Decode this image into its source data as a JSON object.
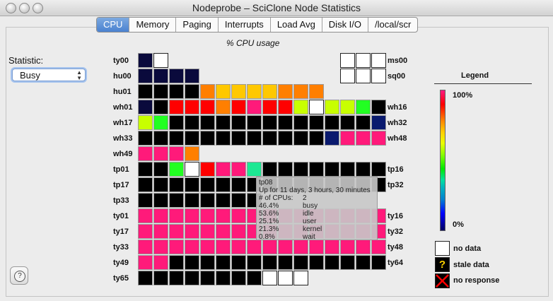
{
  "window": {
    "title": "Nodeprobe – SciClone Node Statistics"
  },
  "tabs": [
    {
      "label": "CPU",
      "selected": true
    },
    {
      "label": "Memory",
      "selected": false
    },
    {
      "label": "Paging",
      "selected": false
    },
    {
      "label": "Interrupts",
      "selected": false
    },
    {
      "label": "Load Avg",
      "selected": false
    },
    {
      "label": "Disk I/O",
      "selected": false
    },
    {
      "label": "/local/scr",
      "selected": false
    }
  ],
  "plot_title": "% CPU usage",
  "statistic": {
    "label": "Statistic:",
    "value": "Busy"
  },
  "help_button": {
    "icon": "question-icon",
    "label": "?"
  },
  "colors": {
    "B": "#000000",
    "N": "#0a0a3c",
    "W": "#ffffff",
    "O": "#ff7f00",
    "Y": "#ffc800",
    "R": "#ff0000",
    "P": "#ff1a7a",
    "L": "#c8ff00",
    "G": "#22ff22",
    "T": "#1de893",
    "U": "#0a1a6e"
  },
  "grid": [
    {
      "left": "ty00",
      "right": "ms00",
      "cells": "NW",
      "right_cells": "WWW"
    },
    {
      "left": "hu00",
      "right": "sq00",
      "cells": "NNNN",
      "right_cells": "WWW"
    },
    {
      "left": "hu01",
      "right": "",
      "cells": "BBBBOYYYYOOO",
      "right_cells": ""
    },
    {
      "left": "wh01",
      "right": "wh16",
      "cells": "NBRRRORPRRLWLLGB",
      "right_cells": ""
    },
    {
      "left": "wh17",
      "right": "wh32",
      "cells": "LGBBBBBBBBBBBBBU",
      "right_cells": ""
    },
    {
      "left": "wh33",
      "right": "wh48",
      "cells": "BBBBBBBBBBBBUPPP",
      "right_cells": ""
    },
    {
      "left": "wh49",
      "right": "",
      "cells": "PPPO",
      "right_cells": ""
    },
    {
      "left": "tp01",
      "right": "tp16",
      "cells": "BBGWRPPTBBBBBBBB",
      "right_cells": ""
    },
    {
      "left": "tp17",
      "right": "tp32",
      "cells": "BBBBBBBBBBBBBBBB",
      "right_cells": ""
    },
    {
      "left": "tp33",
      "right": "",
      "cells": "BBBBBBBB",
      "right_cells": ""
    },
    {
      "left": "ty01",
      "right": "ty16",
      "cells": "PPPPPPPPPPPPPPPP",
      "right_cells": ""
    },
    {
      "left": "ty17",
      "right": "ty32",
      "cells": "PPPPPPPPPPPPPPPP",
      "right_cells": ""
    },
    {
      "left": "ty33",
      "right": "ty48",
      "cells": "PPPPPPPPPPPPPPPP",
      "right_cells": ""
    },
    {
      "left": "ty49",
      "right": "ty64",
      "cells": "PPBBBBBBBBBBBBBB",
      "right_cells": ""
    },
    {
      "left": "ty65",
      "right": "",
      "cells": "BBBBBBBBWWW",
      "right_cells": ""
    }
  ],
  "tooltip": {
    "node": "tp08",
    "uptime": "Up for 11 days, 3 hours, 30 minutes",
    "rows": [
      {
        "k": "# of CPUs:",
        "v": "2"
      },
      {
        "k": "46.4%",
        "v": "busy"
      },
      {
        "k": "53.6%",
        "v": "idle"
      },
      {
        "k": "25.1%",
        "v": "user"
      },
      {
        "k": "21.3%",
        "v": "kernel"
      },
      {
        "k": "0.8%",
        "v": "wait"
      }
    ]
  },
  "legend": {
    "title": "Legend",
    "top": "100%",
    "bottom": "0%",
    "items": [
      {
        "label": "no data",
        "icon": "empty-square-icon"
      },
      {
        "label": "stale data",
        "icon": "question-mark-icon",
        "glyph": "?"
      },
      {
        "label": "no response",
        "icon": "red-x-icon"
      }
    ]
  }
}
